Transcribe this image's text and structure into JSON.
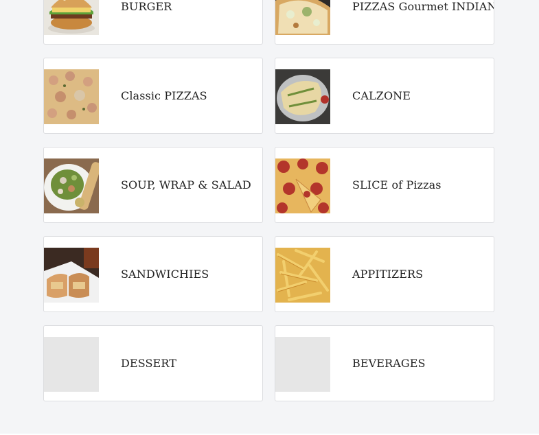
{
  "categories": [
    {
      "label": "BURGER"
    },
    {
      "label": "PIZZAS Gourmet INDIAN"
    },
    {
      "label": "Classic PIZZAS"
    },
    {
      "label": "CALZONE"
    },
    {
      "label": "SOUP, WRAP & SALAD"
    },
    {
      "label": "SLICE of Pizzas"
    },
    {
      "label": "SANDWICHIES"
    },
    {
      "label": "APPITIZERS"
    },
    {
      "label": "DESSERT"
    },
    {
      "label": "BEVERAGES"
    }
  ],
  "colors": {
    "page_background": "#f4f5f7",
    "card_background": "#ffffff",
    "card_border": "#dcdde0",
    "placeholder": "#e6e6e6",
    "text": "#222222"
  }
}
